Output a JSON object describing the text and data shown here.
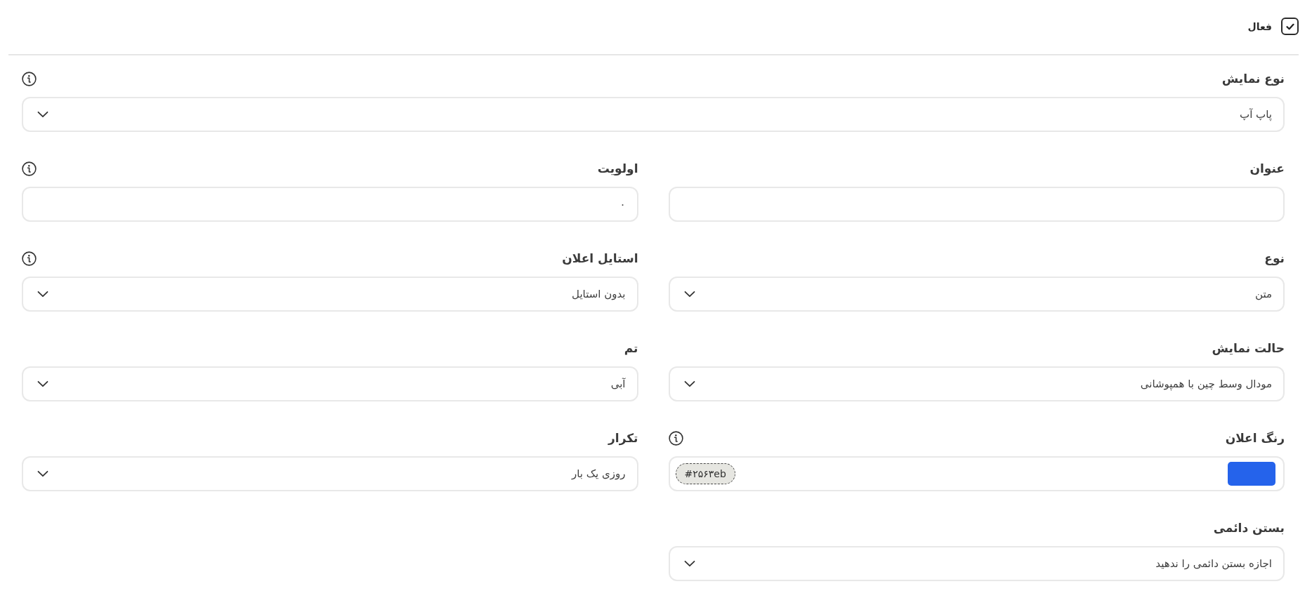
{
  "active": {
    "label": "فعال",
    "checked": true
  },
  "display_type": {
    "label": "نوع نمایش",
    "kind": "select",
    "value": "پاپ آپ",
    "info": true
  },
  "fields": [
    {
      "label": "عنوان",
      "kind": "text",
      "info": false
    },
    {
      "label": "اولویت",
      "kind": "text",
      "value": "۰",
      "info": true
    },
    {
      "label": "نوع",
      "kind": "select",
      "value": "متن",
      "info": false
    },
    {
      "label": "استایل اعلان",
      "kind": "select",
      "value": "بدون استایل",
      "info": true
    },
    {
      "label": "حالت نمایش",
      "kind": "select",
      "value": "مودال وسط چین با همپوشانی",
      "info": false
    },
    {
      "label": "تم",
      "kind": "select",
      "value": "آبی",
      "info": false
    },
    {
      "label": "رنگ اعلان",
      "kind": "color",
      "value": "#۲۵۶۳eb",
      "color": "#2563eb",
      "info": true
    },
    {
      "label": "تکرار",
      "kind": "select",
      "value": "روزی یک بار",
      "info": false
    },
    {
      "label": "بستن دائمی",
      "kind": "select",
      "value": "اجازه بستن دائمی را ندهید",
      "info": false
    }
  ]
}
